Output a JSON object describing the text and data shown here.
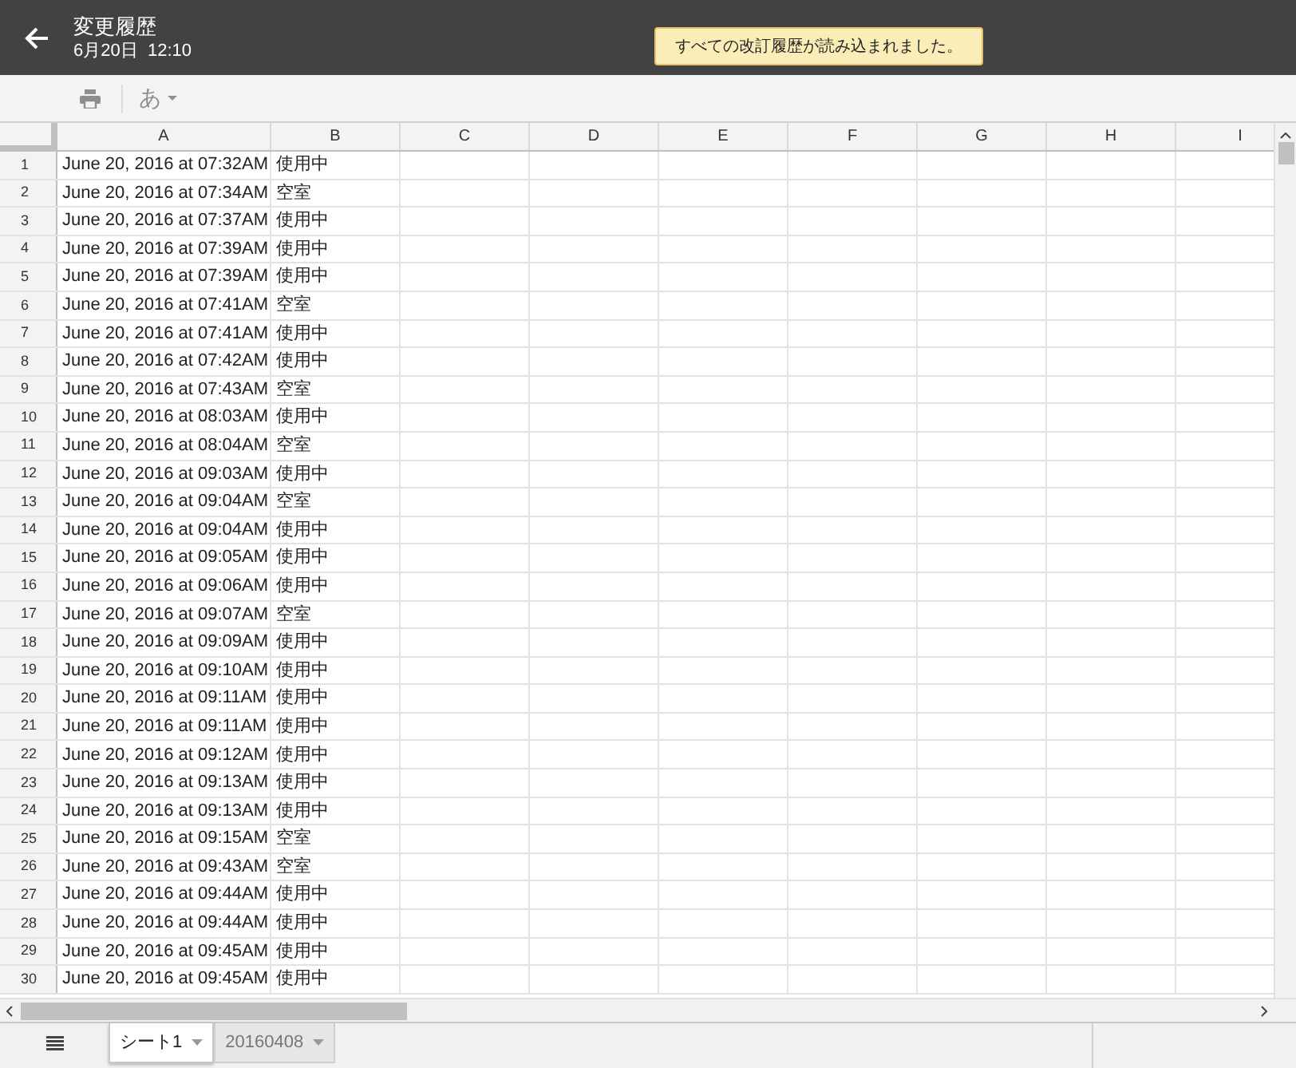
{
  "header": {
    "title": "変更履歴",
    "date": "6月20日  12:10"
  },
  "notification": "すべての改訂履歴が読み込まれました。",
  "toolbar": [
    {
      "kind": "print",
      "disabled": true
    },
    {
      "kind": "input_tool",
      "label": "あ",
      "disabled": true
    }
  ],
  "columns": [
    "A",
    "B",
    "C",
    "D",
    "E",
    "F",
    "G",
    "H",
    "I"
  ],
  "rows": [
    {
      "number": "1",
      "a": "June 20, 2016 at 07:32AM",
      "b": "使用中"
    },
    {
      "number": "2",
      "a": "June 20, 2016 at 07:34AM",
      "b": "空室"
    },
    {
      "number": "3",
      "a": "June 20, 2016 at 07:37AM",
      "b": "使用中"
    },
    {
      "number": "4",
      "a": "June 20, 2016 at 07:39AM",
      "b": "使用中"
    },
    {
      "number": "5",
      "a": "June 20, 2016 at 07:39AM",
      "b": "使用中"
    },
    {
      "number": "6",
      "a": "June 20, 2016 at 07:41AM",
      "b": "空室"
    },
    {
      "number": "7",
      "a": "June 20, 2016 at 07:41AM",
      "b": "使用中"
    },
    {
      "number": "8",
      "a": "June 20, 2016 at 07:42AM",
      "b": "使用中"
    },
    {
      "number": "9",
      "a": "June 20, 2016 at 07:43AM",
      "b": "空室"
    },
    {
      "number": "10",
      "a": "June 20, 2016 at 08:03AM",
      "b": "使用中"
    },
    {
      "number": "11",
      "a": "June 20, 2016 at 08:04AM",
      "b": "空室"
    },
    {
      "number": "12",
      "a": "June 20, 2016 at 09:03AM",
      "b": "使用中"
    },
    {
      "number": "13",
      "a": "June 20, 2016 at 09:04AM",
      "b": "空室"
    },
    {
      "number": "14",
      "a": "June 20, 2016 at 09:04AM",
      "b": "使用中"
    },
    {
      "number": "15",
      "a": "June 20, 2016 at 09:05AM",
      "b": "使用中"
    },
    {
      "number": "16",
      "a": "June 20, 2016 at 09:06AM",
      "b": "使用中"
    },
    {
      "number": "17",
      "a": "June 20, 2016 at 09:07AM",
      "b": "空室"
    },
    {
      "number": "18",
      "a": "June 20, 2016 at 09:09AM",
      "b": "使用中"
    },
    {
      "number": "19",
      "a": "June 20, 2016 at 09:10AM",
      "b": "使用中"
    },
    {
      "number": "20",
      "a": "June 20, 2016 at 09:11AM",
      "b": "使用中"
    },
    {
      "number": "21",
      "a": "June 20, 2016 at 09:11AM",
      "b": "使用中"
    },
    {
      "number": "22",
      "a": "June 20, 2016 at 09:12AM",
      "b": "使用中"
    },
    {
      "number": "23",
      "a": "June 20, 2016 at 09:13AM",
      "b": "使用中"
    },
    {
      "number": "24",
      "a": "June 20, 2016 at 09:13AM",
      "b": "使用中"
    },
    {
      "number": "25",
      "a": "June 20, 2016 at 09:15AM",
      "b": "空室"
    },
    {
      "number": "26",
      "a": "June 20, 2016 at 09:43AM",
      "b": "空室"
    },
    {
      "number": "27",
      "a": "June 20, 2016 at 09:44AM",
      "b": "使用中"
    },
    {
      "number": "28",
      "a": "June 20, 2016 at 09:44AM",
      "b": "使用中"
    },
    {
      "number": "29",
      "a": "June 20, 2016 at 09:45AM",
      "b": "使用中"
    },
    {
      "number": "30",
      "a": "June 20, 2016 at 09:45AM",
      "b": "使用中"
    }
  ],
  "sheets": [
    {
      "label": "シート1",
      "selected": true
    },
    {
      "label": "20160408",
      "selected": false
    }
  ]
}
